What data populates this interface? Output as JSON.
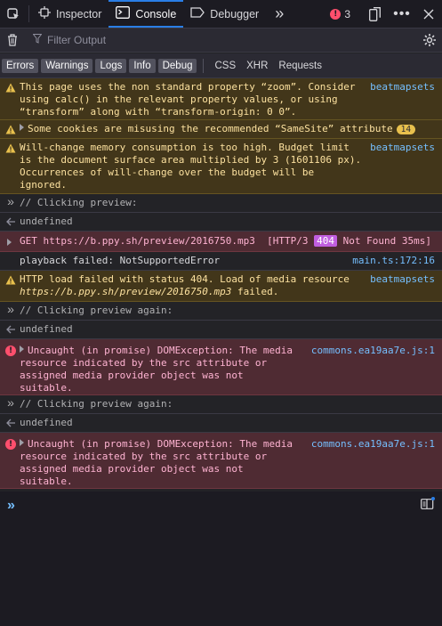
{
  "toolbar": {
    "tabs": [
      {
        "label": "Inspector",
        "icon": "inspector-icon"
      },
      {
        "label": "Console",
        "icon": "console-icon"
      },
      {
        "label": "Debugger",
        "icon": "debugger-icon"
      }
    ],
    "error_count": "3"
  },
  "filter": {
    "placeholder": "Filter Output"
  },
  "categories": {
    "levels": [
      "Errors",
      "Warnings",
      "Logs",
      "Info",
      "Debug"
    ],
    "types": [
      "CSS",
      "XHR",
      "Requests"
    ]
  },
  "messages": {
    "m1": {
      "text": "This page uses the non standard property “zoom”. Consider using calc() in the relevant property values, or using “transform” along with “transform-origin: 0 0”.",
      "source": "beatmapsets"
    },
    "m2": {
      "text": "Some cookies are misusing the recommended “SameSite” attribute",
      "badge": "14"
    },
    "m3": {
      "text": "Will-change memory consumption is too high. Budget limit is the document surface area multiplied by 3 (1601106 px). Occurrences of will-change over the budget will be ignored.",
      "source": "beatmapsets"
    },
    "m4": {
      "text": "// Clicking preview:"
    },
    "m5": {
      "text": "undefined"
    },
    "m6": {
      "method": "GET",
      "url": "https://b.ppy.sh/preview/2016750.mp3",
      "protocol": "[HTTP/3",
      "status": "404",
      "status_text": "Not Found 35ms]"
    },
    "m7": {
      "text": "playback failed: NotSupportedError",
      "source": "main.ts:172:16"
    },
    "m8": {
      "text_a": "HTTP load failed with status 404. Load of media resource",
      "url": "https://b.ppy.sh/preview/2016750.mp3",
      "text_b": "failed.",
      "source": "beatmapsets"
    },
    "m9": {
      "text": "// Clicking preview again:"
    },
    "m10": {
      "text": "undefined"
    },
    "m11": {
      "text": "Uncaught (in promise) DOMException: The media resource indicated by the src attribute or assigned media provider object was not suitable.",
      "source": "commons.ea19aa7e.js:1"
    },
    "m12": {
      "text": "// Clicking preview again:"
    },
    "m13": {
      "text": "undefined"
    },
    "m14": {
      "text": "Uncaught (in promise) DOMException: The media resource indicated by the src attribute or assigned media provider object was not suitable.",
      "source": "commons.ea19aa7e.js:1"
    }
  },
  "colors": {
    "accent": "#2a7ee6",
    "warning_bg": "#42361a",
    "error_bg": "#4f2b33",
    "link": "#75bfff"
  }
}
